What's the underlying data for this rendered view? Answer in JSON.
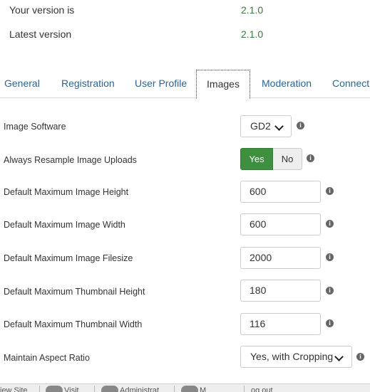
{
  "version": {
    "your_label": "Your version is",
    "your_value": "2.1.0",
    "latest_label": "Latest version",
    "latest_value": "2.1.0"
  },
  "tabs": [
    {
      "label": "General"
    },
    {
      "label": "Registration"
    },
    {
      "label": "User Profile"
    },
    {
      "label": "Images",
      "active": true
    },
    {
      "label": "Moderation"
    },
    {
      "label": "Connecti"
    }
  ],
  "form": {
    "image_software": {
      "label": "Image Software",
      "value": "GD2"
    },
    "resample": {
      "label": "Always Resample Image Uploads",
      "yes": "Yes",
      "no": "No",
      "selected": "Yes"
    },
    "max_height": {
      "label": "Default Maximum Image Height",
      "value": "600"
    },
    "max_width": {
      "label": "Default Maximum Image Width",
      "value": "600"
    },
    "max_filesize": {
      "label": "Default Maximum Image Filesize",
      "value": "2000"
    },
    "thumb_height": {
      "label": "Default Maximum Thumbnail Height",
      "value": "180"
    },
    "thumb_width": {
      "label": "Default Maximum Thumbnail Width",
      "value": "116"
    },
    "aspect_ratio": {
      "label": "Maintain Aspect Ratio",
      "value": "Yes, with Cropping"
    }
  },
  "statusbar": {
    "view_site": "iew Site",
    "visitors": "Visit",
    "administrators": "Administrat",
    "messages": "M",
    "logout": "og out"
  },
  "colors": {
    "link": "#2a6496",
    "success": "#3e8f3e",
    "version_value": "#3c7a3c"
  }
}
